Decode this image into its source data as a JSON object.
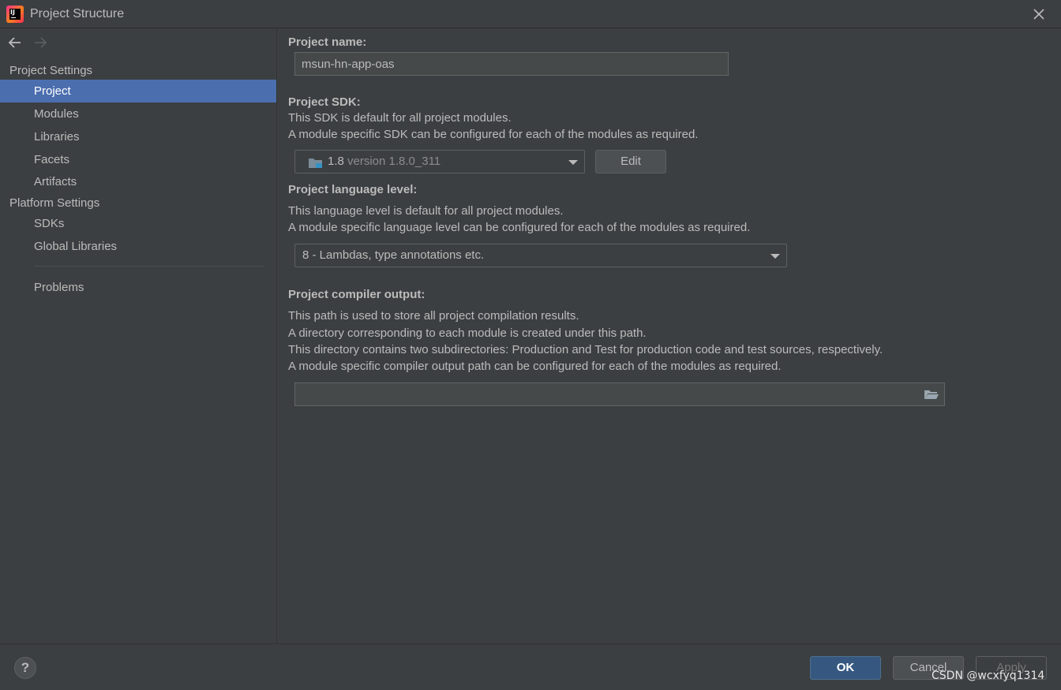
{
  "window": {
    "title": "Project Structure"
  },
  "sidebar": {
    "sections": [
      {
        "label": "Project Settings"
      },
      {
        "label": "Platform Settings"
      }
    ],
    "items": [
      {
        "label": "Project",
        "selected": true
      },
      {
        "label": "Modules"
      },
      {
        "label": "Libraries"
      },
      {
        "label": "Facets"
      },
      {
        "label": "Artifacts"
      },
      {
        "label": "SDKs"
      },
      {
        "label": "Global Libraries"
      },
      {
        "label": "Problems"
      }
    ]
  },
  "content": {
    "project_name": {
      "label": "Project name:",
      "value": "msun-hn-app-oas"
    },
    "project_sdk": {
      "label": "Project SDK:",
      "desc1": "This SDK is default for all project modules.",
      "desc2": "A module specific SDK can be configured for each of the modules as required.",
      "selected_name": "1.8",
      "selected_version": "version 1.8.0_311",
      "edit_label": "Edit"
    },
    "language_level": {
      "label": "Project language level:",
      "desc1": "This language level is default for all project modules.",
      "desc2": "A module specific language level can be configured for each of the modules as required.",
      "selected": "8 - Lambdas, type annotations etc."
    },
    "compiler_output": {
      "label": "Project compiler output:",
      "desc1": "This path is used to store all project compilation results.",
      "desc2": "A directory corresponding to each module is created under this path.",
      "desc3": "This directory contains two subdirectories: Production and Test for production code and test sources, respectively.",
      "desc4": "A module specific compiler output path can be configured for each of the modules as required.",
      "value": ""
    }
  },
  "footer": {
    "help_label": "?",
    "ok_label": "OK",
    "cancel_label": "Cancel",
    "apply_label": "Apply",
    "watermark": "CSDN @wcxfyq1314"
  },
  "colors": {
    "background": "#3c3f41",
    "selection": "#4b6eaf",
    "ok_button": "#365880",
    "text": "#bbbbbb"
  }
}
